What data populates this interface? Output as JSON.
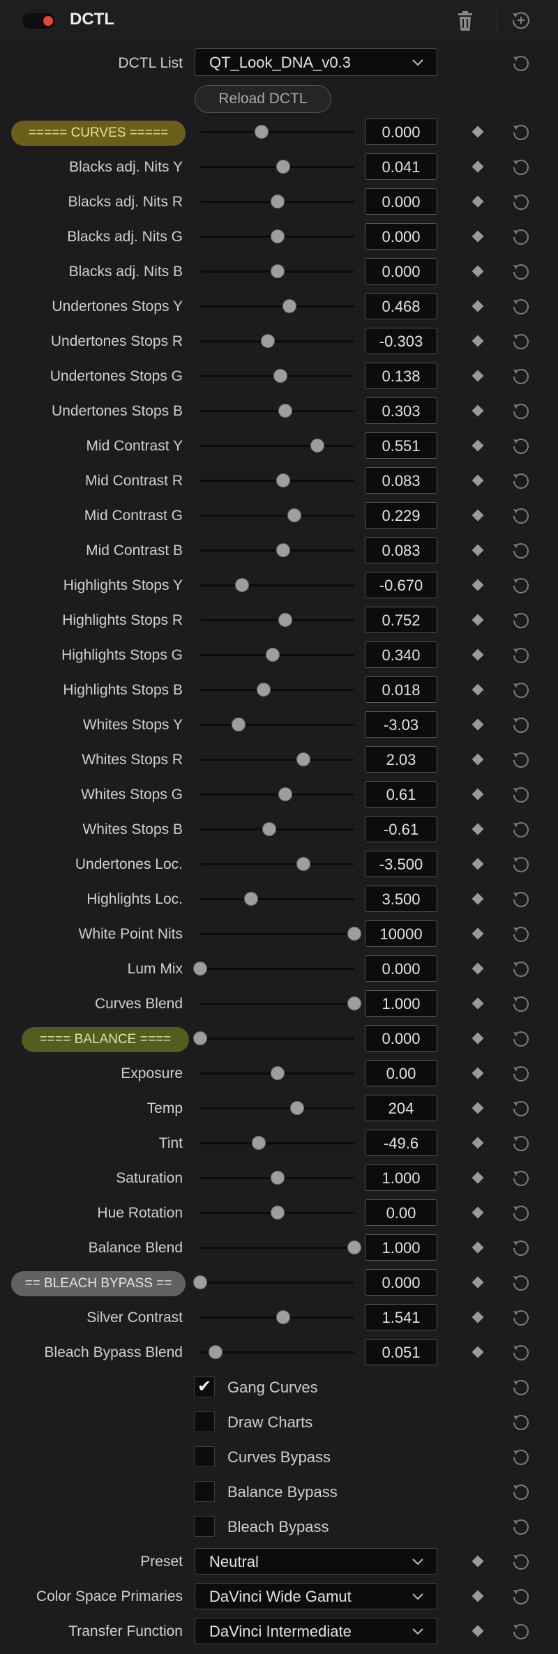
{
  "header": {
    "title": "DCTL"
  },
  "dctl_list": {
    "label": "DCTL List",
    "value": "QT_Look_DNA_v0.3"
  },
  "reload_label": "Reload DCTL",
  "sliders": [
    {
      "label": "===== CURVES =====",
      "value": "0.000",
      "pos": 0.4,
      "section": "curves"
    },
    {
      "label": "Blacks adj. Nits Y",
      "value": "0.041",
      "pos": 0.54
    },
    {
      "label": "Blacks adj. Nits R",
      "value": "0.000",
      "pos": 0.5
    },
    {
      "label": "Blacks adj. Nits G",
      "value": "0.000",
      "pos": 0.5
    },
    {
      "label": "Blacks adj. Nits B",
      "value": "0.000",
      "pos": 0.5
    },
    {
      "label": "Undertones Stops Y",
      "value": "0.468",
      "pos": 0.58
    },
    {
      "label": "Undertones Stops R",
      "value": "-0.303",
      "pos": 0.44
    },
    {
      "label": "Undertones Stops G",
      "value": "0.138",
      "pos": 0.52
    },
    {
      "label": "Undertones Stops B",
      "value": "0.303",
      "pos": 0.55
    },
    {
      "label": "Mid Contrast Y",
      "value": "0.551",
      "pos": 0.76
    },
    {
      "label": "Mid Contrast R",
      "value": "0.083",
      "pos": 0.54
    },
    {
      "label": "Mid Contrast G",
      "value": "0.229",
      "pos": 0.61
    },
    {
      "label": "Mid Contrast B",
      "value": "0.083",
      "pos": 0.54
    },
    {
      "label": "Highlights Stops Y",
      "value": "-0.670",
      "pos": 0.27
    },
    {
      "label": "Highlights Stops R",
      "value": "0.752",
      "pos": 0.55
    },
    {
      "label": "Highlights Stops G",
      "value": "0.340",
      "pos": 0.47
    },
    {
      "label": "Highlights Stops B",
      "value": "0.018",
      "pos": 0.41
    },
    {
      "label": "Whites Stops Y",
      "value": "-3.03",
      "pos": 0.25
    },
    {
      "label": "Whites Stops R",
      "value": "2.03",
      "pos": 0.67
    },
    {
      "label": "Whites Stops G",
      "value": "0.61",
      "pos": 0.55
    },
    {
      "label": "Whites Stops B",
      "value": "-0.61",
      "pos": 0.45
    },
    {
      "label": "Undertones Loc.",
      "value": "-3.500",
      "pos": 0.67
    },
    {
      "label": "Highlights Loc.",
      "value": "3.500",
      "pos": 0.33
    },
    {
      "label": "White Point Nits",
      "value": "10000",
      "pos": 1.0
    },
    {
      "label": "Lum Mix",
      "value": "0.000",
      "pos": 0.0
    },
    {
      "label": "Curves Blend",
      "value": "1.000",
      "pos": 1.0
    },
    {
      "label": "==== BALANCE ====",
      "value": "0.000",
      "pos": 0.0,
      "section": "balance"
    },
    {
      "label": "Exposure",
      "value": "0.00",
      "pos": 0.5
    },
    {
      "label": "Temp",
      "value": "204",
      "pos": 0.63
    },
    {
      "label": "Tint",
      "value": "-49.6",
      "pos": 0.38
    },
    {
      "label": "Saturation",
      "value": "1.000",
      "pos": 0.5
    },
    {
      "label": "Hue Rotation",
      "value": "0.00",
      "pos": 0.5
    },
    {
      "label": "Balance Blend",
      "value": "1.000",
      "pos": 1.0
    },
    {
      "label": "== BLEACH BYPASS ==",
      "value": "0.000",
      "pos": 0.0,
      "section": "bleach"
    },
    {
      "label": "Silver Contrast",
      "value": "1.541",
      "pos": 0.54
    },
    {
      "label": "Bleach Bypass Blend",
      "value": "0.051",
      "pos": 0.1
    }
  ],
  "checkboxes": [
    {
      "label": "Gang Curves",
      "checked": true
    },
    {
      "label": "Draw Charts",
      "checked": false
    },
    {
      "label": "Curves Bypass",
      "checked": false
    },
    {
      "label": "Balance Bypass",
      "checked": false
    },
    {
      "label": "Bleach Bypass",
      "checked": false
    }
  ],
  "dropdowns": [
    {
      "label": "Preset",
      "value": "Neutral"
    },
    {
      "label": "Color Space Primaries",
      "value": "DaVinci Wide Gamut"
    },
    {
      "label": "Transfer Function",
      "value": "DaVinci Intermediate"
    }
  ],
  "section_colors": {
    "curves": {
      "bg": "#6b5f1c",
      "fg": "#e9df95"
    },
    "balance": {
      "bg": "#545c20",
      "fg": "#dfe6a6"
    },
    "bleach": {
      "bg": "#626262",
      "fg": "#e4e4e4"
    }
  },
  "colors": {
    "toggle_dot": "#e8453a"
  },
  "icons": [
    "trash-icon",
    "reset-icon",
    "keyframe-icon",
    "chevron-down-icon",
    "check-icon"
  ]
}
